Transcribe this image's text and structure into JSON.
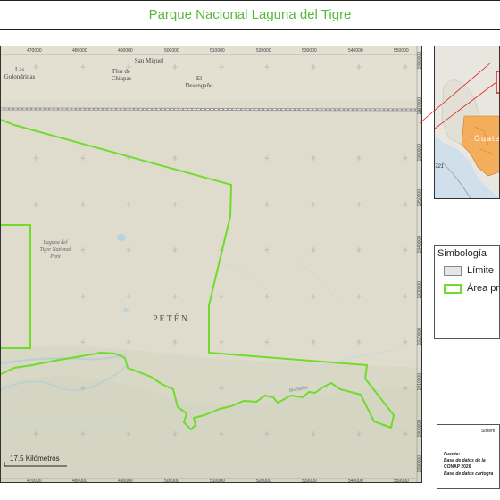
{
  "title": "Parque Nacional Laguna del Tigre",
  "map": {
    "x_ticks": [
      "470000",
      "480000",
      "490000",
      "500000",
      "510000",
      "520000",
      "530000",
      "540000",
      "550000"
    ],
    "y_ticks": [
      "1980000",
      "1970000",
      "1960000",
      "1950000",
      "1940000",
      "1930000",
      "1920000",
      "1910000",
      "1900000",
      "1890000"
    ],
    "places": [
      {
        "text": "Las\nGolondrinas"
      },
      {
        "text": "Flor de\nChiapas"
      },
      {
        "text": "San Miguel"
      },
      {
        "text": "El\nDesengaño"
      }
    ],
    "park_label": "Laguna del\nTigre National\nPark",
    "region_label": "PETÉN",
    "river_label": "Río Sacbic",
    "scale_text": "17.5 Kilómetros",
    "colors": {
      "boundary": "#6fdc2a",
      "terrain": "#dedbcd",
      "water": "#bcd3dc"
    }
  },
  "inset": {
    "country_label": "Guate",
    "road_label": "721",
    "colors": {
      "water": "#cfe0ec",
      "land": "#e8e6df",
      "country": "#f4ad5a",
      "frame": "#e02020"
    }
  },
  "legend": {
    "title": "Simbología",
    "items": [
      {
        "label": "Límite",
        "swatch": "gray-fill"
      },
      {
        "label": "Área pro",
        "swatch": "green-outline"
      }
    ]
  },
  "source_box": {
    "title": "Sistem",
    "lines": [
      "Fuente:",
      "Base de datos de la",
      "CONAP 2026",
      "Base de datos cartogra"
    ]
  }
}
